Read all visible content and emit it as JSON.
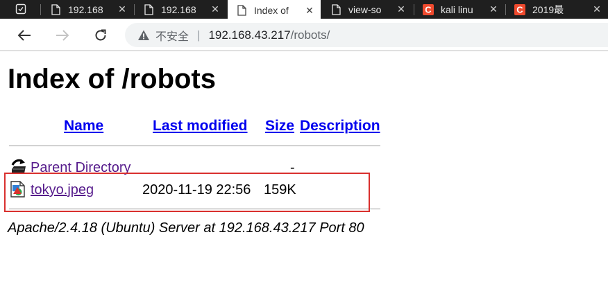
{
  "tabs": [
    {
      "label": "192.168",
      "favicon": "tab-page-icon",
      "active": false
    },
    {
      "label": "192.168",
      "favicon": "document-icon",
      "active": false
    },
    {
      "label": "Index of",
      "favicon": "document-icon",
      "active": true
    },
    {
      "label": "view-so",
      "favicon": "document-icon",
      "active": false
    },
    {
      "label": "kali linu",
      "favicon": "csdn-c-icon",
      "active": false
    },
    {
      "label": "2019最",
      "favicon": "csdn-c-icon",
      "active": false
    }
  ],
  "toolbar": {
    "security_label": "不安全",
    "divider": "|",
    "url_host": "192.168.43.217",
    "url_path": "/robots/"
  },
  "page": {
    "title": "Index of /robots",
    "columns": {
      "name": "Name",
      "last_modified": "Last modified",
      "size": "Size",
      "description": "Description"
    },
    "parent": {
      "name": "Parent Directory",
      "size": "-"
    },
    "files": [
      {
        "name": "tokyo.jpeg",
        "last_modified": "2020-11-19 22:56",
        "size": "159K",
        "description": ""
      }
    ],
    "address": "Apache/2.4.18 (Ubuntu) Server at 192.168.43.217 Port 80"
  },
  "colors": {
    "link": "#0000ee",
    "visited_link": "#551a8b",
    "highlight_box": "#d9302e",
    "tabstrip": "#1f1f1f",
    "csdn_red": "#f04a2e"
  }
}
